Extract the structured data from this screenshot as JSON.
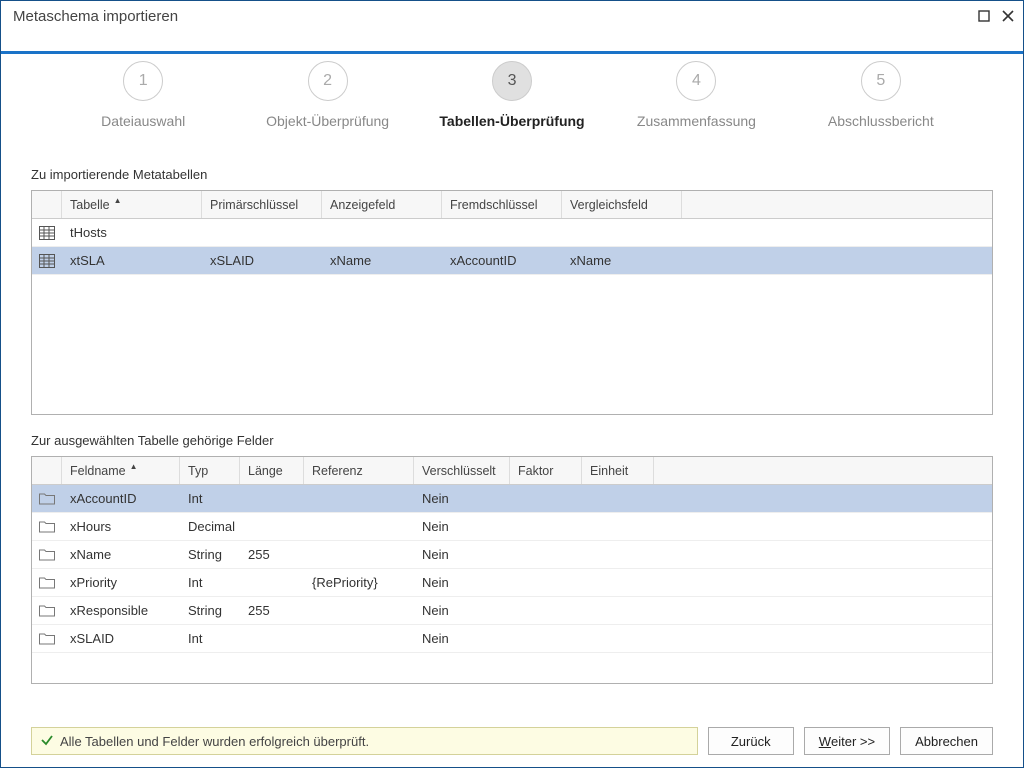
{
  "window": {
    "title": "Metaschema importieren"
  },
  "steps": [
    {
      "num": "1",
      "label": "Dateiauswahl"
    },
    {
      "num": "2",
      "label": "Objekt-Überprüfung"
    },
    {
      "num": "3",
      "label": "Tabellen-Überprüfung"
    },
    {
      "num": "4",
      "label": "Zusammenfassung"
    },
    {
      "num": "5",
      "label": "Abschlussbericht"
    }
  ],
  "current_step": 3,
  "section_tables": "Zu importierende Metatabellen",
  "tables_columns": {
    "tabelle": "Tabelle",
    "pk": "Primärschlüssel",
    "display": "Anzeigefeld",
    "fk": "Fremdschlüssel",
    "cmp": "Vergleichsfeld"
  },
  "tables_rows": [
    {
      "tabelle": "tHosts",
      "pk": "",
      "display": "",
      "fk": "",
      "cmp": "",
      "selected": false
    },
    {
      "tabelle": "xtSLA",
      "pk": "xSLAID",
      "display": "xName",
      "fk": "xAccountID",
      "cmp": "xName",
      "selected": true
    }
  ],
  "section_fields": "Zur ausgewählten Tabelle gehörige Felder",
  "fields_columns": {
    "name": "Feldname",
    "type": "Typ",
    "len": "Länge",
    "ref": "Referenz",
    "enc": "Verschlüsselt",
    "fac": "Faktor",
    "unit": "Einheit"
  },
  "fields_rows": [
    {
      "name": "xAccountID",
      "type": "Int",
      "len": "",
      "ref": "",
      "enc": "Nein",
      "fac": "",
      "unit": "",
      "selected": true
    },
    {
      "name": "xHours",
      "type": "Decimal",
      "len": "",
      "ref": "",
      "enc": "Nein",
      "fac": "",
      "unit": "",
      "selected": false
    },
    {
      "name": "xName",
      "type": "String",
      "len": "255",
      "ref": "",
      "enc": "Nein",
      "fac": "",
      "unit": "",
      "selected": false
    },
    {
      "name": "xPriority",
      "type": "Int",
      "len": "",
      "ref": "{RePriority}",
      "enc": "Nein",
      "fac": "",
      "unit": "",
      "selected": false
    },
    {
      "name": "xResponsible",
      "type": "String",
      "len": "255",
      "ref": "",
      "enc": "Nein",
      "fac": "",
      "unit": "",
      "selected": false
    },
    {
      "name": "xSLAID",
      "type": "Int",
      "len": "",
      "ref": "",
      "enc": "Nein",
      "fac": "",
      "unit": "",
      "selected": false
    }
  ],
  "status": "Alle Tabellen und Felder wurden erfolgreich überprüft.",
  "buttons": {
    "back": "Zurück",
    "next_prefix": "W",
    "next_rest": "eiter >>",
    "cancel": "Abbrechen"
  }
}
